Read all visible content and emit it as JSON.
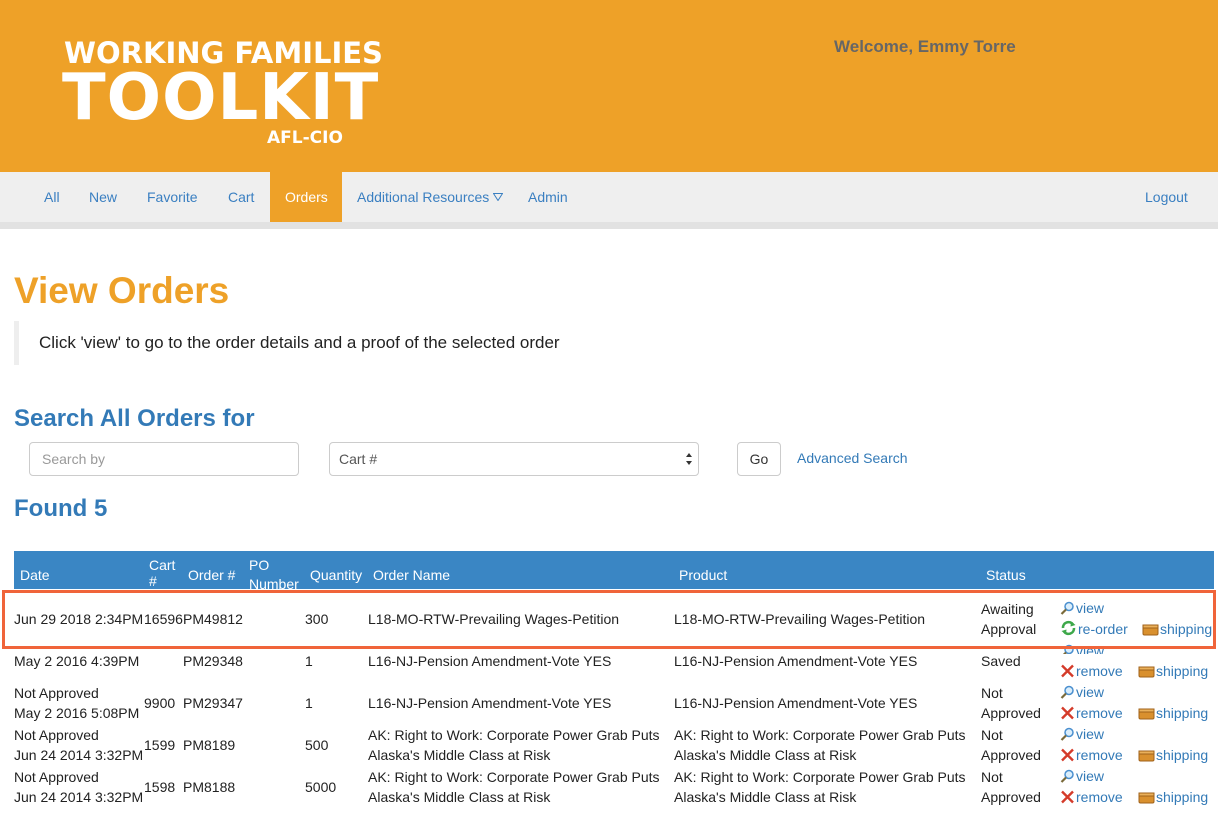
{
  "header": {
    "logo_line1": "WORKING FAMILIES",
    "logo_line2": "TOOLKIT",
    "logo_line3": "AFL-CIO",
    "welcome": "Welcome, Emmy Torre",
    "background": "#eea128"
  },
  "nav": {
    "items": [
      {
        "label": "All"
      },
      {
        "label": "New"
      },
      {
        "label": "Favorite"
      },
      {
        "label": "Cart"
      },
      {
        "label": "Orders",
        "active": true
      },
      {
        "label": "Additional Resources"
      },
      {
        "label": "Admin"
      }
    ],
    "logout": "Logout"
  },
  "page": {
    "title": "View Orders",
    "note": "Click 'view' to go to the order details and a proof of the selected order"
  },
  "search": {
    "title": "Search All Orders for",
    "placeholder": "Search by",
    "select_value": "Cart #",
    "go_label": "Go",
    "advanced_label": "Advanced Search"
  },
  "results": {
    "found": "Found 5",
    "columns": {
      "date": "Date",
      "cart_a": "Cart",
      "cart_b": "#",
      "order": "Order #",
      "po_a": "PO",
      "po_b": "Number",
      "quantity": "Quantity",
      "order_name": "Order Name",
      "product": "Product",
      "status": "Status"
    },
    "rows": [
      {
        "date": "Jun 29 2018 2:34PM",
        "cart": "16596",
        "order": "PM49812",
        "quantity": "300",
        "order_name": "L18-MO-RTW-Prevailing Wages-Petition",
        "product": "L18-MO-RTW-Prevailing Wages-Petition",
        "status_a": "Awaiting",
        "status_b": "Approval",
        "action_view": "view",
        "action_reorder": "re-order",
        "action_shipping": "shipping"
      },
      {
        "date": "May 2 2016 4:39PM",
        "order": "PM29348",
        "quantity": "1",
        "order_name": "L16-NJ-Pension Amendment-Vote YES",
        "product": "L16-NJ-Pension Amendment-Vote YES",
        "status_a": "Saved",
        "action_view": "view",
        "action_remove": "remove",
        "action_shipping": "shipping"
      },
      {
        "pre_date": "Not Approved",
        "date": "May 2 2016 5:08PM",
        "cart": "9900",
        "order": "PM29347",
        "quantity": "1",
        "order_name": "L16-NJ-Pension Amendment-Vote YES",
        "product": "L16-NJ-Pension Amendment-Vote YES",
        "status_a": "Not",
        "status_b": "Approved",
        "action_view": "view",
        "action_remove": "remove",
        "action_shipping": "shipping"
      },
      {
        "pre_date": "Not Approved",
        "date": "Jun 24 2014 3:32PM",
        "cart": "1599",
        "order": "PM8189",
        "quantity": "500",
        "order_name_a": "AK: Right to Work: Corporate Power Grab Puts",
        "order_name_b": "Alaska's Middle Class at Risk",
        "product_a": "AK: Right to Work: Corporate Power Grab Puts",
        "product_b": "Alaska's Middle Class at Risk",
        "status_a": "Not",
        "status_b": "Approved",
        "action_view": "view",
        "action_remove": "remove",
        "action_shipping": "shipping"
      },
      {
        "pre_date": "Not Approved",
        "date": "Jun 24 2014 3:32PM",
        "cart": "1598",
        "order": "PM8188",
        "quantity": "5000",
        "order_name_a": "AK: Right to Work: Corporate Power Grab Puts",
        "order_name_b": "Alaska's Middle Class at Risk",
        "product_a": "AK: Right to Work: Corporate Power Grab Puts",
        "product_b": "Alaska's Middle Class at Risk",
        "status_a": "Not",
        "status_b": "Approved",
        "action_view": "view",
        "action_remove": "remove",
        "action_shipping": "shipping"
      }
    ]
  },
  "colors": {
    "accent_orange": "#eea128",
    "link_blue": "#337ab7",
    "table_header": "#3a86c4",
    "highlight_border": "#f0643a"
  }
}
